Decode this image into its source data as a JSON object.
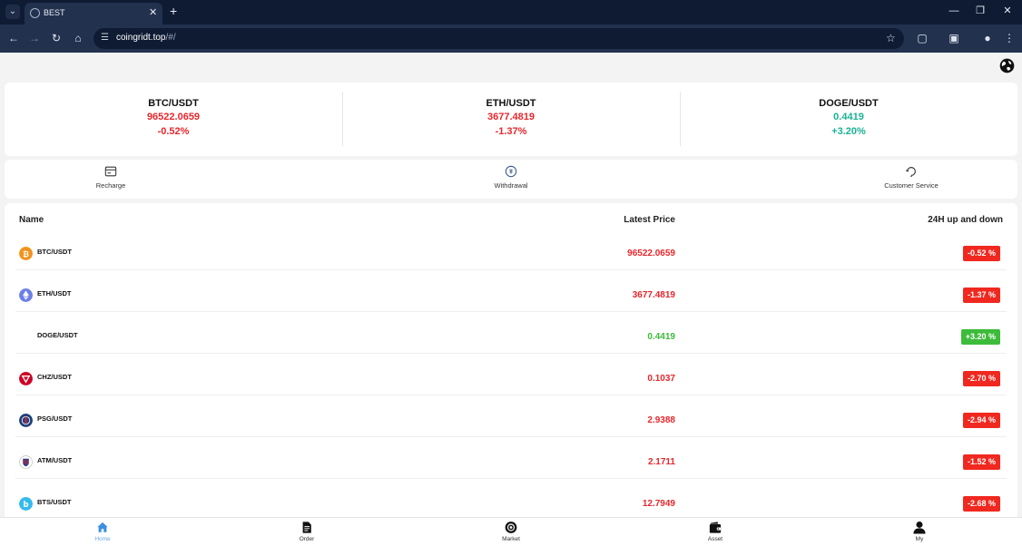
{
  "browser": {
    "tab_title": "BEST",
    "url_host": "coingridt.top",
    "url_path": "/#/"
  },
  "tickers": [
    {
      "pair": "BTC/USDT",
      "price": "96522.0659",
      "change": "-0.52%",
      "color": "#e8262b"
    },
    {
      "pair": "ETH/USDT",
      "price": "3677.4819",
      "change": "-1.37%",
      "color": "#e8262b"
    },
    {
      "pair": "DOGE/USDT",
      "price": "0.4419",
      "change": "+3.20%",
      "color": "#19b394"
    }
  ],
  "actions": [
    {
      "label": "Recharge",
      "icon": "recharge-icon"
    },
    {
      "label": "Withdrawal",
      "icon": "withdrawal-icon"
    },
    {
      "label": "Customer Service",
      "icon": "customer-service-icon"
    }
  ],
  "market": {
    "headers": {
      "name": "Name",
      "price": "Latest Price",
      "change": "24H up and down"
    },
    "rows": [
      {
        "pair": "BTC/USDT",
        "price": "96522.0659",
        "change": "-0.52 %",
        "trend": "down",
        "icon": "btc-icon",
        "icon_color": "#f2931b"
      },
      {
        "pair": "ETH/USDT",
        "price": "3677.4819",
        "change": "-1.37 %",
        "trend": "down",
        "icon": "eth-icon",
        "icon_color": "#6c7fe8"
      },
      {
        "pair": "DOGE/USDT",
        "price": "0.4419",
        "change": "+3.20 %",
        "trend": "up",
        "icon": "",
        "icon_color": ""
      },
      {
        "pair": "CHZ/USDT",
        "price": "0.1037",
        "change": "-2.70 %",
        "trend": "down",
        "icon": "chz-icon",
        "icon_color": "#cd0124"
      },
      {
        "pair": "PSG/USDT",
        "price": "2.9388",
        "change": "-2.94 %",
        "trend": "down",
        "icon": "psg-icon",
        "icon_color": "#1e3f7c"
      },
      {
        "pair": "ATM/USDT",
        "price": "2.1711",
        "change": "-1.52 %",
        "trend": "down",
        "icon": "atm-icon",
        "icon_color": "#d8242c"
      },
      {
        "pair": "BTS/USDT",
        "price": "12.7949",
        "change": "-2.68 %",
        "trend": "down",
        "icon": "bts-icon",
        "icon_color": "#35baeb"
      }
    ]
  },
  "colors": {
    "down": "#e8262b",
    "down_badge": "#f0281f",
    "up": "#3dbb3a",
    "up_badge": "#3dbb3a"
  },
  "bottom_nav": [
    {
      "label": "Home",
      "icon": "home-icon",
      "active": true
    },
    {
      "label": "Order",
      "icon": "order-icon",
      "active": false
    },
    {
      "label": "Market",
      "icon": "market-icon",
      "active": false
    },
    {
      "label": "Asset",
      "icon": "wallet-icon",
      "active": false
    },
    {
      "label": "My",
      "icon": "user-icon",
      "active": false
    }
  ]
}
